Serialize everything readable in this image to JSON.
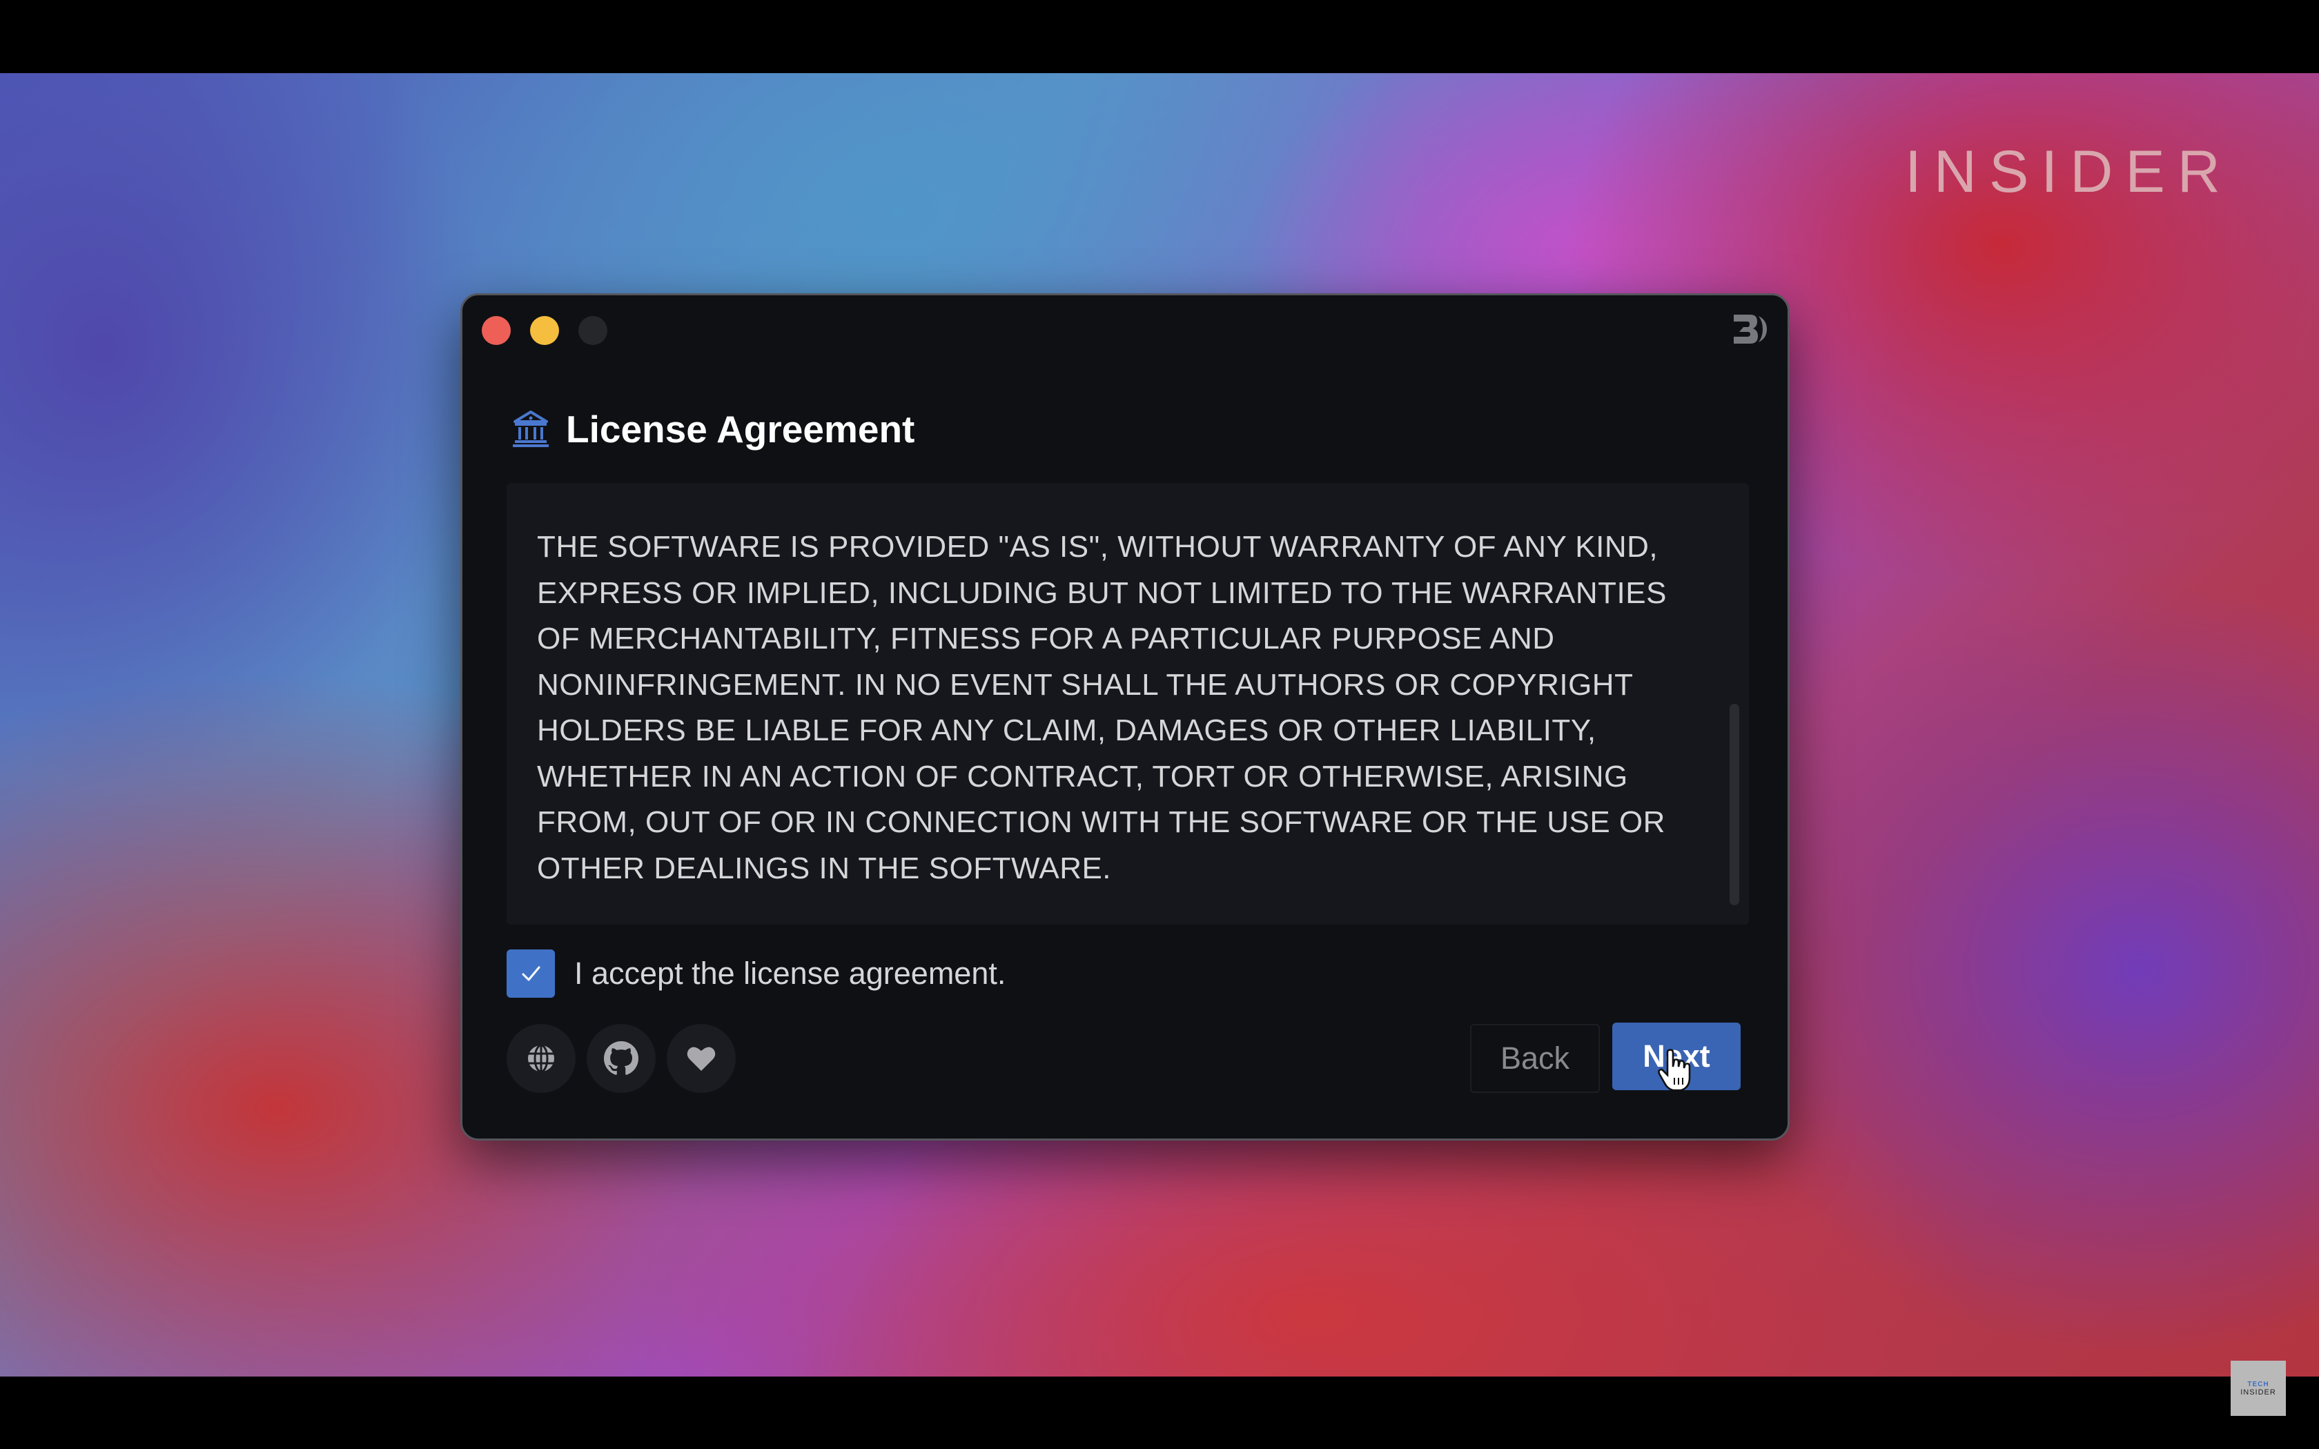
{
  "overlay": {
    "brand": "INSIDER",
    "badge_line1": "TECH",
    "badge_line2": "INSIDER"
  },
  "window": {
    "traffic_lights": [
      "close",
      "minimize",
      "maximize-disabled"
    ],
    "app_logo": "app-logo-icon",
    "header": {
      "icon": "bank-icon",
      "title": "License Agreement"
    },
    "license": {
      "text": "THE SOFTWARE IS PROVIDED \"AS IS\", WITHOUT WARRANTY OF ANY KIND, EXPRESS OR IMPLIED, INCLUDING BUT NOT LIMITED TO THE WARRANTIES OF MERCHANTABILITY, FITNESS FOR A PARTICULAR PURPOSE AND NONINFRINGEMENT. IN NO EVENT SHALL THE AUTHORS OR COPYRIGHT HOLDERS BE LIABLE FOR ANY CLAIM, DAMAGES OR OTHER LIABILITY, WHETHER IN AN ACTION OF CONTRACT, TORT OR OTHERWISE, ARISING FROM, OUT OF OR IN CONNECTION WITH THE SOFTWARE OR THE USE OR OTHER DEALINGS IN THE SOFTWARE.",
      "scroll_position": "bottom"
    },
    "accept": {
      "label": "I accept the license agreement.",
      "checked": true
    },
    "footer_icons": [
      "globe-icon",
      "github-icon",
      "heart-icon"
    ],
    "buttons": {
      "back": "Back",
      "next": "Next"
    }
  },
  "colors": {
    "accent": "#3a64b4",
    "checkbox": "#3f72c7",
    "close": "#ed5f57",
    "minimize": "#f5be3f"
  }
}
